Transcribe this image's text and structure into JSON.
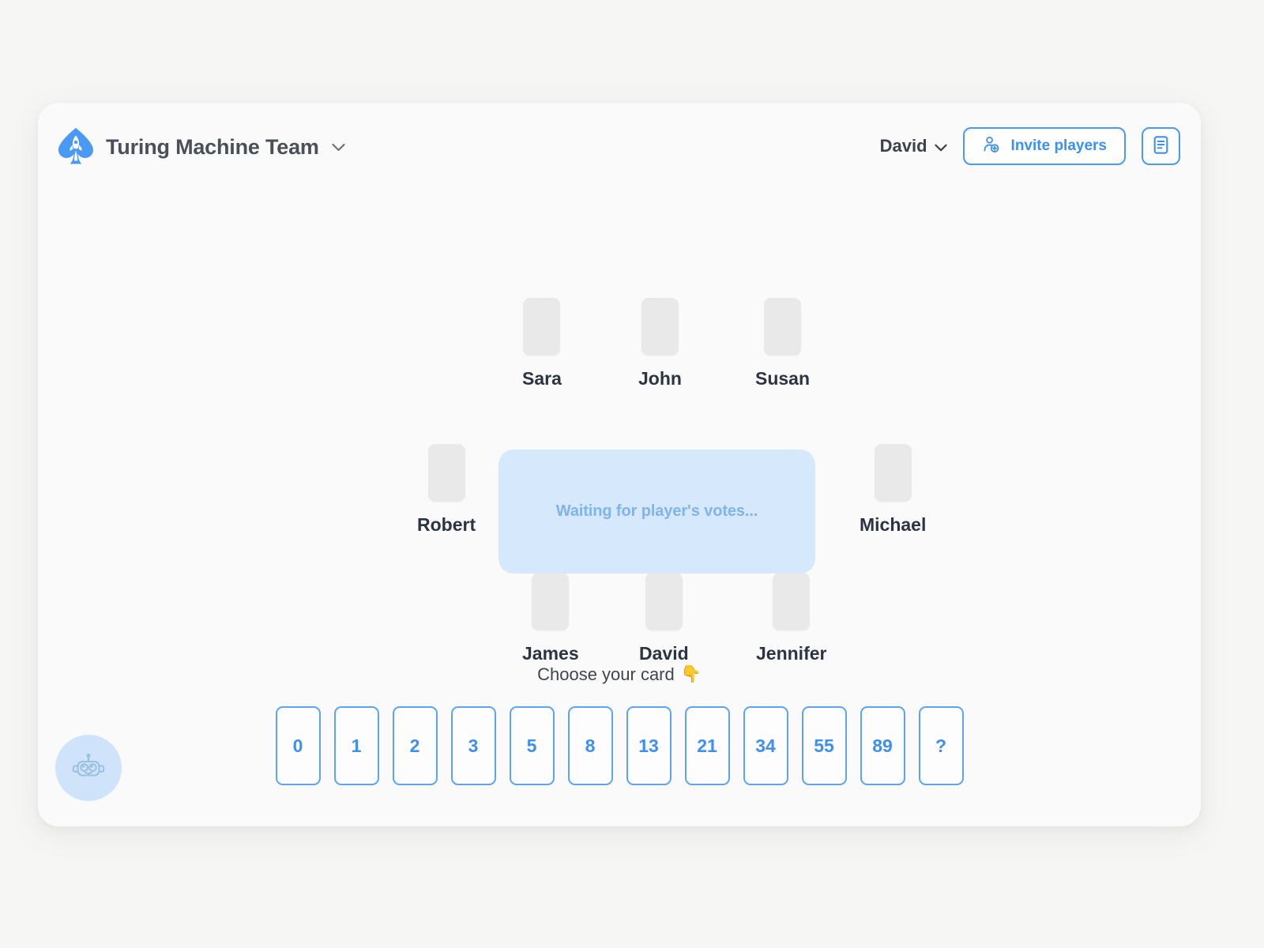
{
  "header": {
    "logo_icon": "spade-rocket-logo",
    "team_name": "Turing Machine Team",
    "team_chevron_icon": "chevron-down-icon",
    "user_name": "David",
    "user_chevron_icon": "chevron-down-icon",
    "invite_label": "Invite players",
    "invite_icon": "add-user-icon",
    "notes_icon": "document-list-icon"
  },
  "table": {
    "waiting_text": "Waiting for player's votes...",
    "seats": [
      {
        "name": "Sara",
        "card": "",
        "revealed": false
      },
      {
        "name": "John",
        "card": "",
        "revealed": false
      },
      {
        "name": "Susan",
        "card": "",
        "revealed": false
      },
      {
        "name": "Robert",
        "card": "",
        "revealed": false
      },
      {
        "name": "Michael",
        "card": "",
        "revealed": false
      },
      {
        "name": "James",
        "card": "",
        "revealed": false
      },
      {
        "name": "David",
        "card": "",
        "revealed": false
      },
      {
        "name": "Jennifer",
        "card": "",
        "revealed": false
      }
    ]
  },
  "deck": {
    "label": "Choose your card",
    "label_emoji": "👇",
    "cards": [
      "0",
      "1",
      "2",
      "3",
      "5",
      "8",
      "13",
      "21",
      "34",
      "55",
      "89",
      "?"
    ],
    "selected": null
  },
  "assistant": {
    "icon": "robot-icon"
  },
  "colors": {
    "accent_blue": "#3d90f0",
    "border_blue": "#5aa4f3",
    "waiting_bg": "#d6e8fb",
    "waiting_text": "#7fb4ec",
    "seat_card_bg": "#e9e9e9",
    "name_text": "#2b3443",
    "page_bg": "#f6f6f4",
    "panel_bg": "#fafafa"
  }
}
